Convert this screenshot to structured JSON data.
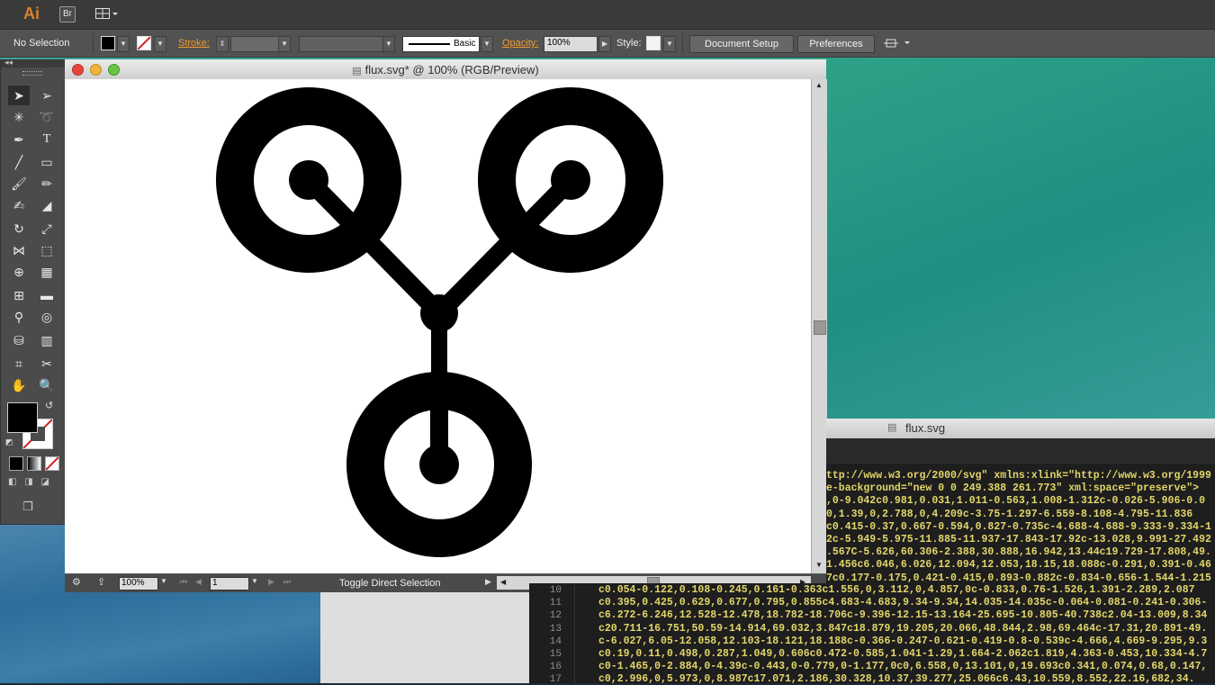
{
  "app_bar": {
    "logo": "Ai",
    "bridge_label": "Br",
    "arrange_icon": "arrange-documents-icon"
  },
  "control_bar": {
    "selection_status": "No Selection",
    "stroke_label": "Stroke:",
    "brush_label": "Basic",
    "opacity_label": "Opacity:",
    "opacity_value": "100%",
    "style_label": "Style:",
    "document_setup_label": "Document Setup",
    "preferences_label": "Preferences",
    "fill_color": "#000000"
  },
  "document": {
    "title": "flux.svg* @ 100% (RGB/Preview)",
    "zoom_value": "100%",
    "artboard_number": "1",
    "status_text": "Toggle Direct Selection"
  },
  "code_window": {
    "title": "flux.svg",
    "upper_lines": [
      "ttp://www.w3.org/2000/svg\" xmlns:xlink=\"http://www.w3.org/1999",
      "e-background=\"new 0 0 249.388 261.773\" xml:space=\"preserve\">",
      ",0-9.042c0.981,0.031,1.011-0.563,1.008-1.312c-0.026-5.906-0.0",
      "0,1.39,0,2.788,0,4.209c-3.75-1.297-6.559-8.108-4.795-11.836",
      "c0.415-0.37,0.667-0.594,0.827-0.735c-4.688-4.688-9.333-9.334-1",
      "2c-5.949-5.975-11.885-11.937-17.843-17.92c-13.028,9.991-27.492",
      ".567C-5.626,60.306-2.388,30.888,16.942,13.44c19.729-17.808,49.",
      "1.456c6.046,6.026,12.094,12.053,18.15,18.088c-0.291,0.391-0.46",
      "7c0.177-0.175,0.421-0.415,0.893-0.882c-0.834-0.656-1.544-1.215"
    ],
    "lower_lines": [
      {
        "num": "10",
        "code": "c0.054-0.122,0.108-0.245,0.161-0.363c1.556,0,3.112,0,4.857,0c-0.833,0.76-1.526,1.391-2.289,2.087"
      },
      {
        "num": "11",
        "code": "c0.395,0.425,0.629,0.677,0.795,0.855c4.683-4.683,9.34-9.34,14.035-14.035c-0.064-0.081-0.241-0.306-"
      },
      {
        "num": "12",
        "code": "c6.272-6.246,12.528-12.478,18.782-18.706c-9.396-12.15-13.164-25.695-10.805-40.738c2.04-13.009,8.34"
      },
      {
        "num": "13",
        "code": "c20.711-16.751,50.59-14.914,69.032,3.847c18.879,19.205,20.066,48.844,2.98,69.464c-17.31,20.891-49."
      },
      {
        "num": "14",
        "code": "c-6.027,6.05-12.058,12.103-18.121,18.188c-0.366-0.247-0.621-0.419-0.8-0.539c-4.666,4.669-9.295,9.3"
      },
      {
        "num": "15",
        "code": "c0.19,0.11,0.498,0.287,1.049,0.606c0.472-0.585,1.041-1.29,1.664-2.062c1.819,4.363-0.453,10.334-4.7"
      },
      {
        "num": "16",
        "code": "c0-1.465,0-2.884,0-4.39c-0.443,0-0.779,0-1.177,0c0,6.558,0,13.101,0,19.693c0.341,0.074,0.68,0.147,"
      },
      {
        "num": "17",
        "code": "c0,2.996,0,5.973,0,8.987c17.071,2.186,30.328,10.37,39.277,25.066c6.43,10.559,8.552,22.16,682,34."
      }
    ]
  },
  "tools": [
    "selection-tool-icon",
    "direct-selection-tool-icon",
    "magic-wand-tool-icon",
    "lasso-tool-icon",
    "pen-tool-icon",
    "type-tool-icon",
    "line-tool-icon",
    "rectangle-tool-icon",
    "paintbrush-tool-icon",
    "pencil-tool-icon",
    "blob-brush-tool-icon",
    "eraser-tool-icon",
    "rotate-tool-icon",
    "scale-tool-icon",
    "width-tool-icon",
    "free-transform-tool-icon",
    "shape-builder-tool-icon",
    "perspective-grid-tool-icon",
    "mesh-tool-icon",
    "gradient-tool-icon",
    "eyedropper-tool-icon",
    "blend-tool-icon",
    "symbol-sprayer-tool-icon",
    "column-graph-tool-icon",
    "artboard-tool-icon",
    "slice-tool-icon",
    "hand-tool-icon",
    "zoom-tool-icon"
  ]
}
